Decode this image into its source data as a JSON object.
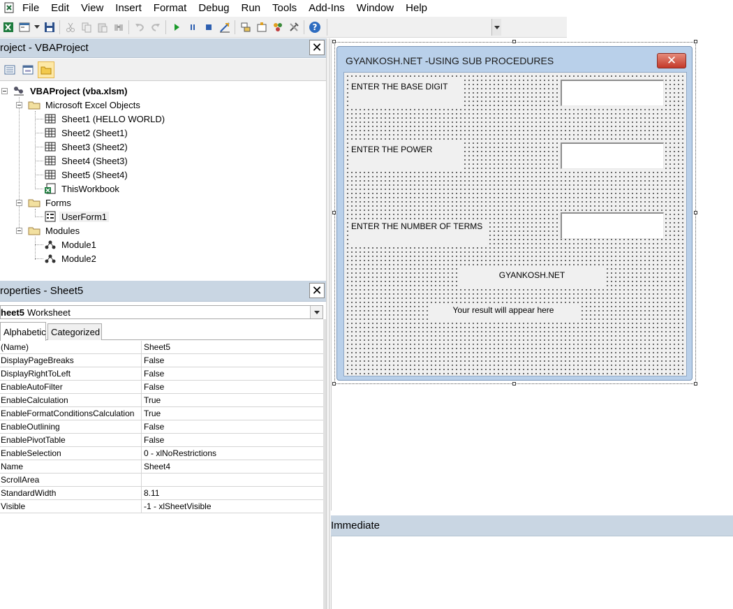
{
  "menubar": {
    "items": [
      {
        "label": "File"
      },
      {
        "label": "Edit"
      },
      {
        "label": "View"
      },
      {
        "label": "Insert"
      },
      {
        "label": "Format"
      },
      {
        "label": "Debug"
      },
      {
        "label": "Run"
      },
      {
        "label": "Tools"
      },
      {
        "label": "Add-Ins"
      },
      {
        "label": "Window"
      },
      {
        "label": "Help"
      }
    ]
  },
  "project": {
    "title": "roject - VBAProject",
    "tree": {
      "root": "VBAProject (vba.xlsm)",
      "excel_objects": "Microsoft Excel Objects",
      "sheets": [
        "Sheet1 (HELLO WORLD)",
        "Sheet2 (Sheet1)",
        "Sheet3 (Sheet2)",
        "Sheet4 (Sheet3)",
        "Sheet5 (Sheet4)"
      ],
      "workbook": "ThisWorkbook",
      "forms": "Forms",
      "userform": "UserForm1",
      "modules": "Modules",
      "module_items": [
        "Module1",
        "Module2"
      ]
    }
  },
  "properties": {
    "title": "roperties - Sheet5",
    "object_name": "heet5",
    "object_type": "Worksheet",
    "tabs": {
      "alphabetic": "Alphabetic",
      "categorized": "Categorized"
    },
    "rows": [
      {
        "name": "(Name)",
        "value": "Sheet5"
      },
      {
        "name": "DisplayPageBreaks",
        "value": "False"
      },
      {
        "name": "DisplayRightToLeft",
        "value": "False"
      },
      {
        "name": "EnableAutoFilter",
        "value": "False"
      },
      {
        "name": "EnableCalculation",
        "value": "True"
      },
      {
        "name": "EnableFormatConditionsCalculation",
        "value": "True"
      },
      {
        "name": "EnableOutlining",
        "value": "False"
      },
      {
        "name": "EnablePivotTable",
        "value": "False"
      },
      {
        "name": "EnableSelection",
        "value": "0 - xlNoRestrictions"
      },
      {
        "name": "Name",
        "value": "Sheet4"
      },
      {
        "name": "ScrollArea",
        "value": ""
      },
      {
        "name": "StandardWidth",
        "value": "8.11"
      },
      {
        "name": "Visible",
        "value": "-1 - xlSheetVisible"
      }
    ]
  },
  "userform": {
    "title": "GYANKOSH.NET -USING SUB PROCEDURES",
    "close_glyph": "✕",
    "label_base": "ENTER THE BASE DIGIT",
    "label_power": "ENTER THE POWER",
    "label_terms": "ENTER THE NUMBER OF TERMS",
    "label_brand": "GYANKOSH.NET",
    "label_result": "Your result will appear here"
  },
  "immediate": {
    "title": "Immediate"
  },
  "colors": {
    "panel_header": "#c9d6e3",
    "form_frame": "#b9d0ea",
    "form_close": "#c4392a"
  }
}
